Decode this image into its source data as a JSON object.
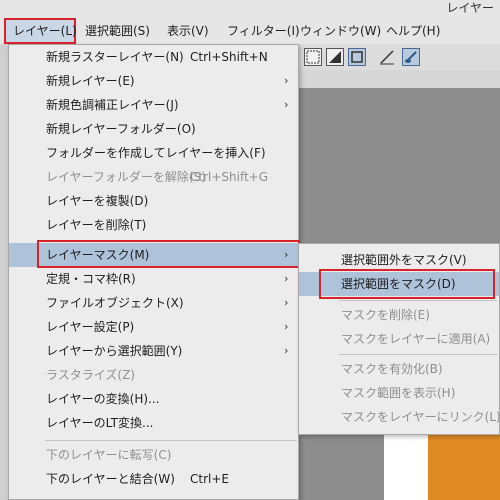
{
  "window": {
    "title": "レイヤー"
  },
  "menubar": {
    "items": [
      {
        "label": "レイヤー(L)"
      },
      {
        "label": "選択範囲(S)"
      },
      {
        "label": "表示(V)"
      },
      {
        "label": "フィルター(I)"
      },
      {
        "label": "ウィンドウ(W)"
      },
      {
        "label": "ヘルプ(H)"
      }
    ]
  },
  "layer_menu": {
    "items": [
      {
        "label": "新規ラスターレイヤー(N)",
        "shortcut": "Ctrl+Shift+N"
      },
      {
        "label": "新規レイヤー(E)",
        "submenu": "›"
      },
      {
        "label": "新規色調補正レイヤー(J)",
        "submenu": "›"
      },
      {
        "label": "新規レイヤーフォルダー(O)"
      },
      {
        "label": "フォルダーを作成してレイヤーを挿入(F)"
      },
      {
        "label": "レイヤーフォルダーを解除(S)",
        "shortcut": "Ctrl+Shift+G",
        "disabled": true
      },
      {
        "label": "レイヤーを複製(D)"
      },
      {
        "label": "レイヤーを削除(T)"
      },
      {
        "label": "レイヤーマスク(M)",
        "submenu": "›",
        "highlighted": true
      },
      {
        "label": "定規・コマ枠(R)",
        "submenu": "›"
      },
      {
        "label": "ファイルオブジェクト(X)",
        "submenu": "›"
      },
      {
        "label": "レイヤー設定(P)",
        "submenu": "›"
      },
      {
        "label": "レイヤーから選択範囲(Y)",
        "submenu": "›"
      },
      {
        "label": "ラスタライズ(Z)",
        "disabled": true
      },
      {
        "label": "レイヤーの変換(H)..."
      },
      {
        "label": "レイヤーのLT変換..."
      },
      {
        "label": "下のレイヤーに転写(C)",
        "disabled": true
      },
      {
        "label": "下のレイヤーと結合(W)",
        "shortcut": "Ctrl+E"
      }
    ]
  },
  "mask_submenu": {
    "items": [
      {
        "label": "選択範囲外をマスク(V)"
      },
      {
        "label": "選択範囲をマスク(D)",
        "highlighted": true
      },
      {
        "label": "マスクを削除(E)",
        "disabled": true
      },
      {
        "label": "マスクをレイヤーに適用(A)",
        "disabled": true
      },
      {
        "label": "マスクを有効化(B)",
        "disabled": true
      },
      {
        "label": "マスク範囲を表示(H)",
        "disabled": true
      },
      {
        "label": "マスクをレイヤーにリンク(L)",
        "disabled": true
      }
    ]
  },
  "colors": {
    "highlight": "#aec2da",
    "annotation_red": "#d8232a",
    "canvas_orange": "#e08a23"
  },
  "toolbar_icons": [
    "select-rect-icon",
    "select-invert-icon",
    "select-frame-icon",
    "pen-line-icon",
    "brush-icon"
  ]
}
